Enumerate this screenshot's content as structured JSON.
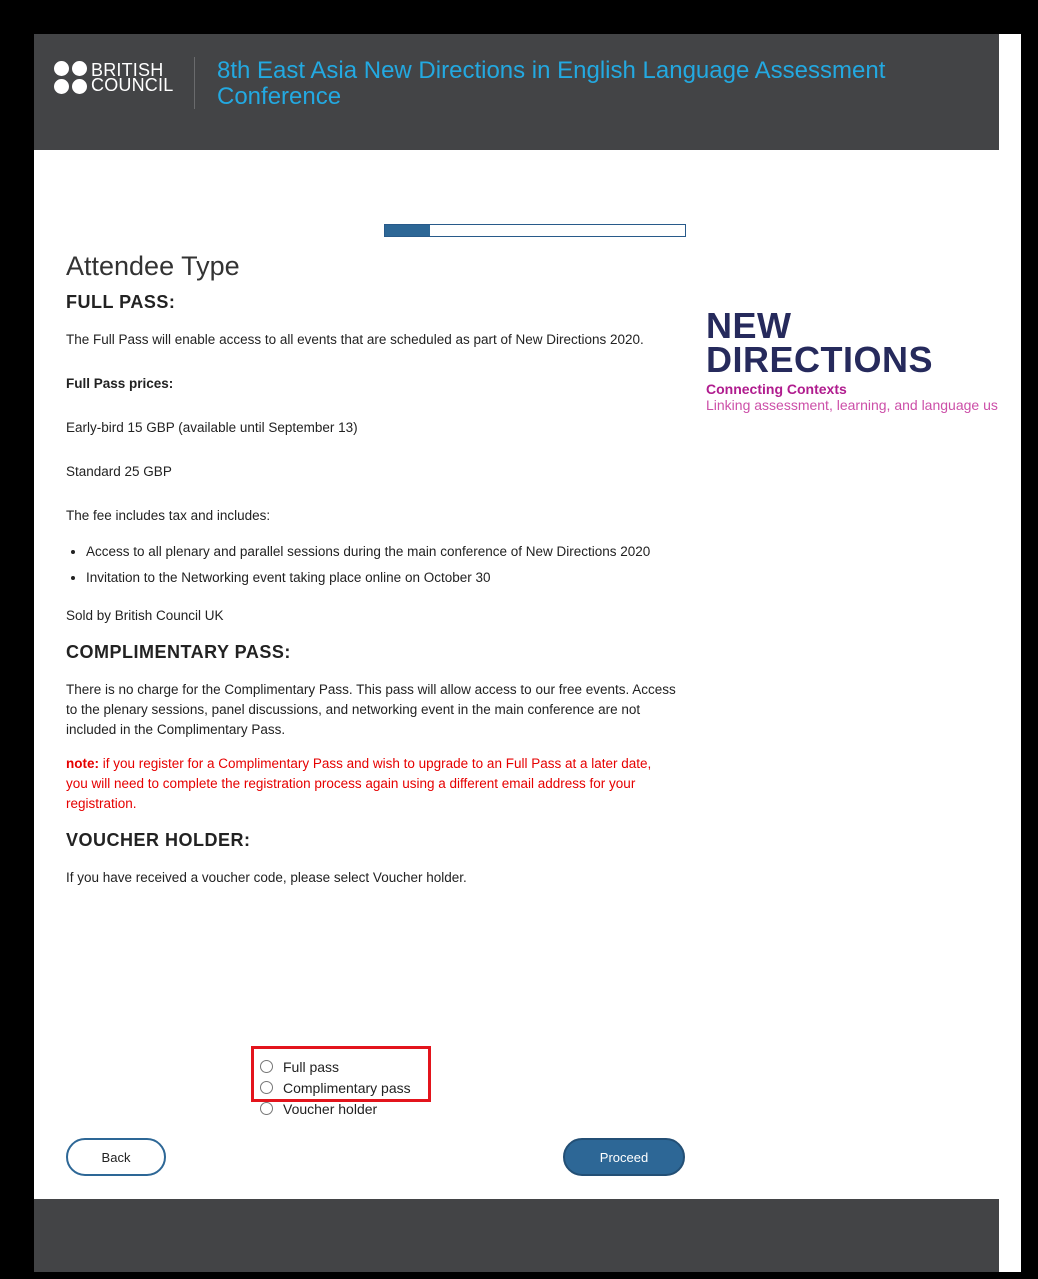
{
  "header": {
    "logo_line1": "BRITISH",
    "logo_line2": "COUNCIL",
    "title": "8th East Asia New Directions in English Language Assessment Conference"
  },
  "progress": {
    "fraction": 0.15
  },
  "content": {
    "page_title": "Attendee Type",
    "full_pass": {
      "heading": "FULL PASS:",
      "intro": "The Full Pass will enable access to all events that are scheduled as part of New Directions 2020.",
      "prices_label": "Full Pass prices:",
      "early_bird": "Early-bird 15 GBP (available until September 13)",
      "standard": "Standard 25 GBP",
      "fee_text": "The fee includes tax and includes:",
      "bullets": [
        "Access to all plenary and parallel sessions during the main conference of New Directions 2020",
        "Invitation to the Networking event taking place online on October 30"
      ],
      "sold_by": "Sold by British Council UK"
    },
    "complimentary": {
      "heading": "COMPLIMENTARY PASS:",
      "text": "There is no charge for the Complimentary Pass. This pass will allow access to our free events. Access to the plenary sessions, panel discussions, and networking event in the main conference are not included in the Complimentary Pass.",
      "note_label": "note:",
      "note_text": " if you register for a Complimentary Pass and wish to upgrade to an Full Pass at a later date, you will need to complete the registration process again using a different email address for your registration."
    },
    "voucher": {
      "heading": "VOUCHER HOLDER:",
      "text": "If you have received a voucher code, please select Voucher holder."
    }
  },
  "brand": {
    "line1": "NEW",
    "line2": "DIRECTIONS",
    "tagline": "Connecting Contexts",
    "subtitle": "Linking assessment, learning, and language use"
  },
  "options": [
    "Full pass",
    "Complimentary pass",
    "Voucher holder"
  ],
  "buttons": {
    "back": "Back",
    "proceed": "Proceed"
  },
  "colors": {
    "header_bg": "#434446",
    "title": "#23a9e1",
    "primary": "#2d6796",
    "note": "#e60000",
    "highlight": "#e3141c"
  }
}
